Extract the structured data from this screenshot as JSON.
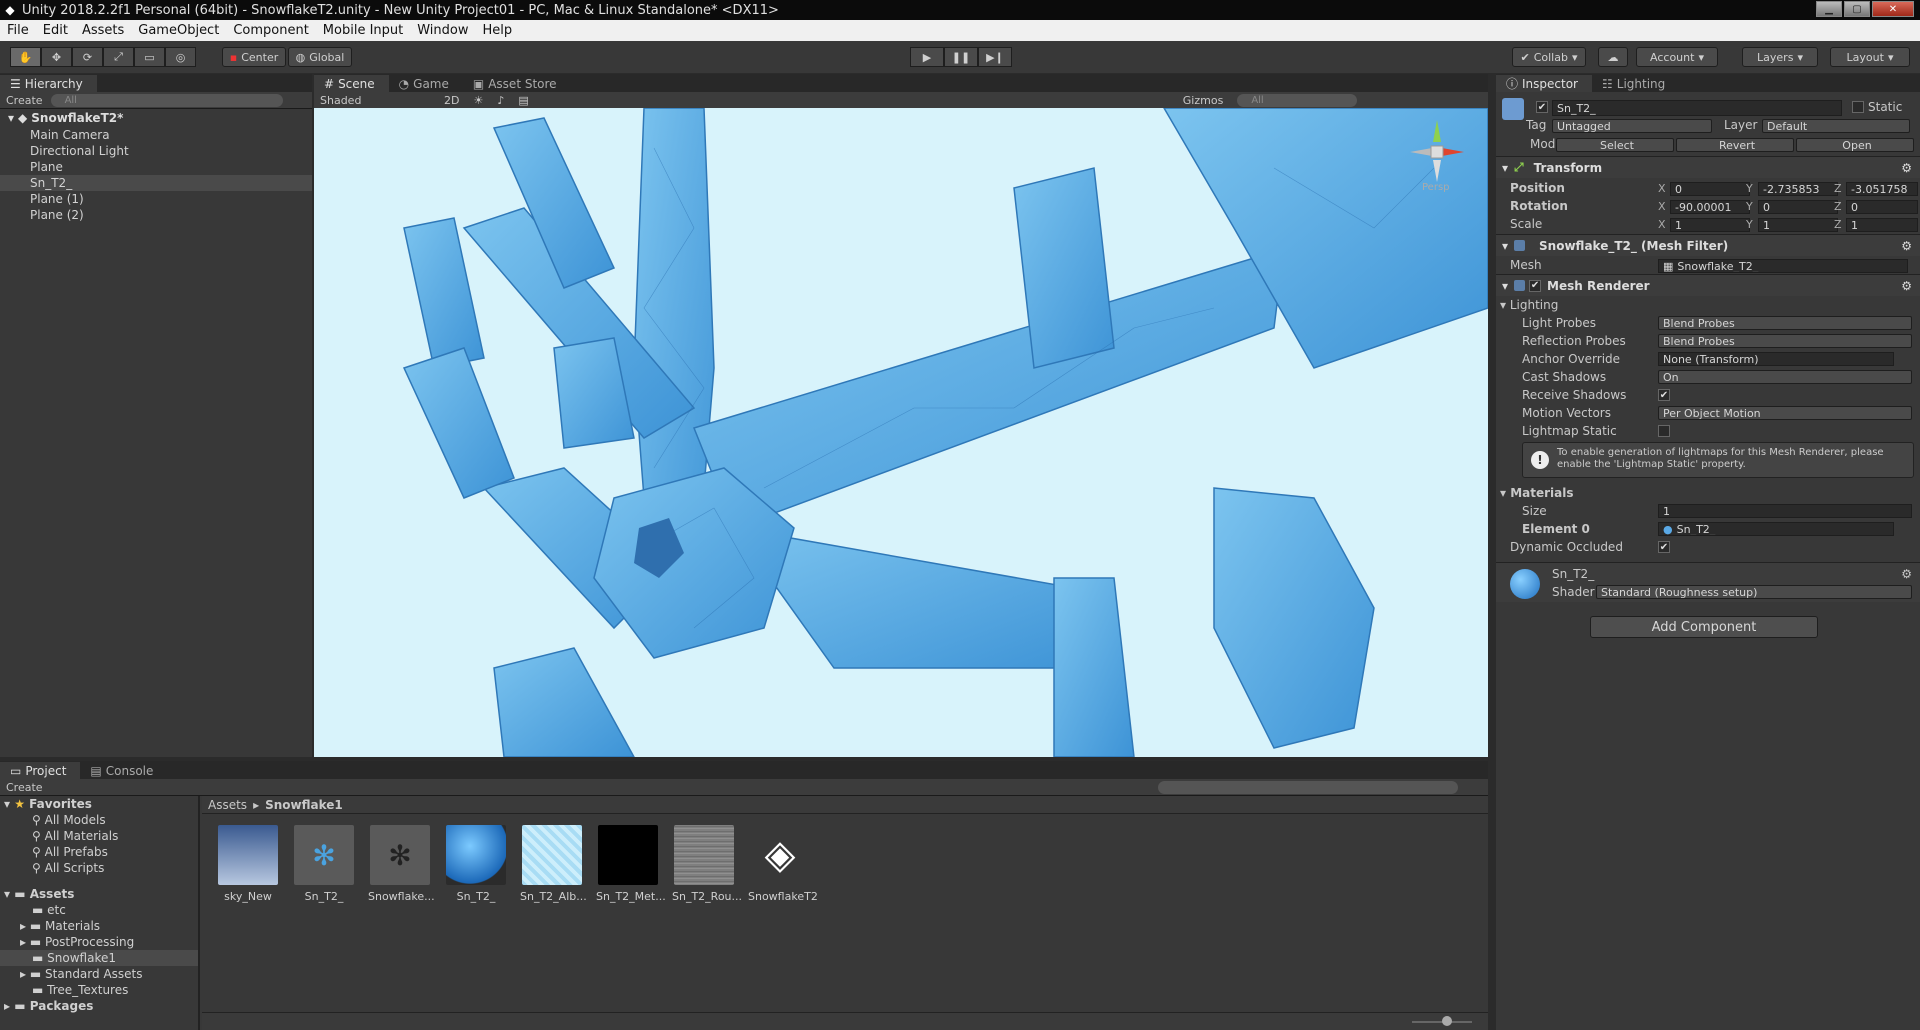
{
  "window": {
    "title": "Unity 2018.2.2f1 Personal (64bit) - SnowflakeT2.unity - New Unity Project01 - PC, Mac & Linux Standalone* <DX11>"
  },
  "menu": [
    "File",
    "Edit",
    "Assets",
    "GameObject",
    "Component",
    "Mobile Input",
    "Window",
    "Help"
  ],
  "toolbar": {
    "pivot": "Center",
    "space": "Global",
    "collab": "Collab",
    "account": "Account",
    "layers": "Layers",
    "layout": "Layout"
  },
  "hierarchy": {
    "tab": "Hierarchy",
    "create": "Create",
    "search_placeholder": "All",
    "scene_name": "SnowflakeT2*",
    "items": [
      "Main Camera",
      "Directional Light",
      "Plane",
      "Sn_T2_",
      "Plane (1)",
      "Plane (2)"
    ]
  },
  "scene_view": {
    "tabs": [
      "Scene",
      "Game",
      "Asset Store"
    ],
    "shading": "Shaded",
    "mode_2d": "2D",
    "gizmos": "Gizmos",
    "search_placeholder": "All",
    "persp": "Persp"
  },
  "inspector": {
    "tabs": [
      "Inspector",
      "Lighting"
    ],
    "object_name": "Sn_T2_",
    "static_label": "Static",
    "tag_label": "Tag",
    "tag_value": "Untagged",
    "layer_label": "Layer",
    "layer_value": "Default",
    "model_label": "Model",
    "model_buttons": [
      "Select",
      "Revert",
      "Open"
    ],
    "transform": {
      "title": "Transform",
      "position_label": "Position",
      "position": {
        "x": "0",
        "y": "-2.735853",
        "z": "-3.051758"
      },
      "rotation_label": "Rotation",
      "rotation": {
        "x": "-90.00001",
        "y": "0",
        "z": "0"
      },
      "scale_label": "Scale",
      "scale": {
        "x": "1",
        "y": "1",
        "z": "1"
      }
    },
    "mesh_filter": {
      "title": "Snowflake_T2_ (Mesh Filter)",
      "mesh_label": "Mesh",
      "mesh_value": "Snowflake_T2_"
    },
    "mesh_renderer": {
      "title": "Mesh Renderer",
      "lighting_label": "Lighting",
      "light_probes_label": "Light Probes",
      "light_probes": "Blend Probes",
      "reflection_probes_label": "Reflection Probes",
      "reflection_probes": "Blend Probes",
      "anchor_override_label": "Anchor Override",
      "anchor_override": "None (Transform)",
      "cast_shadows_label": "Cast Shadows",
      "cast_shadows": "On",
      "receive_shadows_label": "Receive Shadows",
      "motion_vectors_label": "Motion Vectors",
      "motion_vectors": "Per Object Motion",
      "lightmap_static_label": "Lightmap Static",
      "info_message": "To enable generation of lightmaps for this Mesh Renderer, please enable the 'Lightmap Static' property.",
      "materials_label": "Materials",
      "size_label": "Size",
      "size_value": "1",
      "element0_label": "Element 0",
      "element0_value": "Sn_T2_",
      "dynamic_occluded_label": "Dynamic Occluded"
    },
    "material": {
      "name": "Sn_T2_",
      "shader_label": "Shader",
      "shader_value": "Standard (Roughness setup)"
    },
    "add_component": "Add Component"
  },
  "project": {
    "tabs": [
      "Project",
      "Console"
    ],
    "create": "Create",
    "favorites_label": "Favorites",
    "favorites": [
      "All Models",
      "All Materials",
      "All Prefabs",
      "All Scripts"
    ],
    "assets_label": "Assets",
    "asset_folders": [
      "etc",
      "Materials",
      "PostProcessing",
      "Snowflake1",
      "Standard Assets",
      "Tree_Textures"
    ],
    "packages_label": "Packages",
    "breadcrumb_root": "Assets",
    "breadcrumb_current": "Snowflake1",
    "assets": [
      "sky_New",
      "Sn_T2_",
      "Snowflake...",
      "Sn_T2_",
      "Sn_T2_Alb...",
      "Sn_T2_Met...",
      "Sn_T2_Rou...",
      "SnowflakeT2"
    ]
  },
  "colors": {
    "scene_bg": "#d8f3fb",
    "snowflake": "#4aa3e0",
    "selection": "#3e5f96"
  }
}
